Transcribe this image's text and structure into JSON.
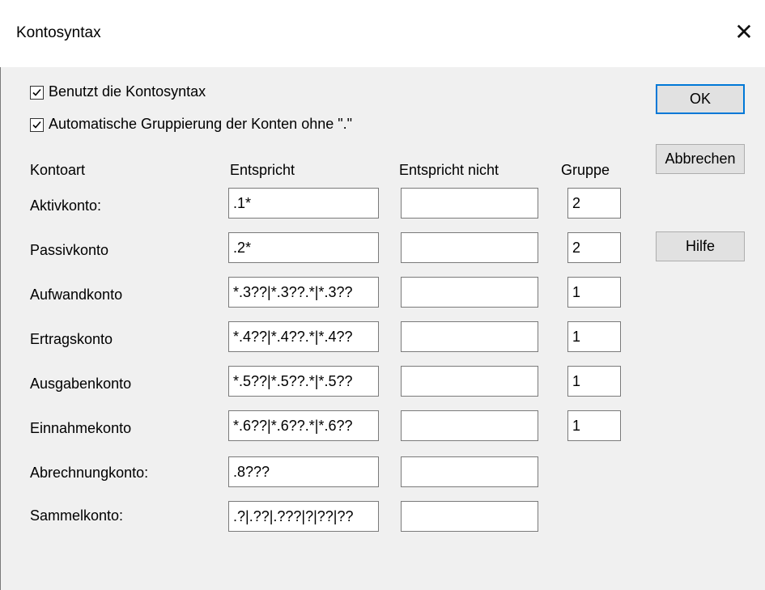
{
  "window": {
    "title": "Kontosyntax"
  },
  "options": {
    "use_syntax": {
      "label": "Benutzt die Kontosyntax",
      "checked": true
    },
    "auto_group": {
      "label": "Automatische Gruppierung der Konten ohne \".\"",
      "checked": true
    }
  },
  "headers": {
    "type": "Kontoart",
    "match": "Entspricht",
    "no_match": "Entspricht nicht",
    "group": "Gruppe"
  },
  "rows": [
    {
      "label": "Aktivkonto:",
      "match": ".1*",
      "no_match": "",
      "group": "2"
    },
    {
      "label": "Passivkonto",
      "match": ".2*",
      "no_match": "",
      "group": "2"
    },
    {
      "label": "Aufwandkonto",
      "match": "*.3??|*.3??.*|*.3??",
      "no_match": "",
      "group": "1"
    },
    {
      "label": "Ertragskonto",
      "match": "*.4??|*.4??.*|*.4??",
      "no_match": "",
      "group": "1"
    },
    {
      "label": "Ausgabenkonto",
      "match": "*.5??|*.5??.*|*.5??",
      "no_match": "",
      "group": "1"
    },
    {
      "label": "Einnahmekonto",
      "match": "*.6??|*.6??.*|*.6??",
      "no_match": "",
      "group": "1"
    },
    {
      "label": "Abrechnungkonto:",
      "match": ".8???",
      "no_match": ""
    },
    {
      "label": "Sammelkonto:",
      "match": ".?|.??|.???|?|??|??",
      "no_match": ""
    }
  ],
  "buttons": {
    "ok": "OK",
    "cancel": "Abbrechen",
    "help": "Hilfe"
  },
  "icons": {
    "close": "close-icon",
    "checkmark": "checkmark-icon"
  }
}
